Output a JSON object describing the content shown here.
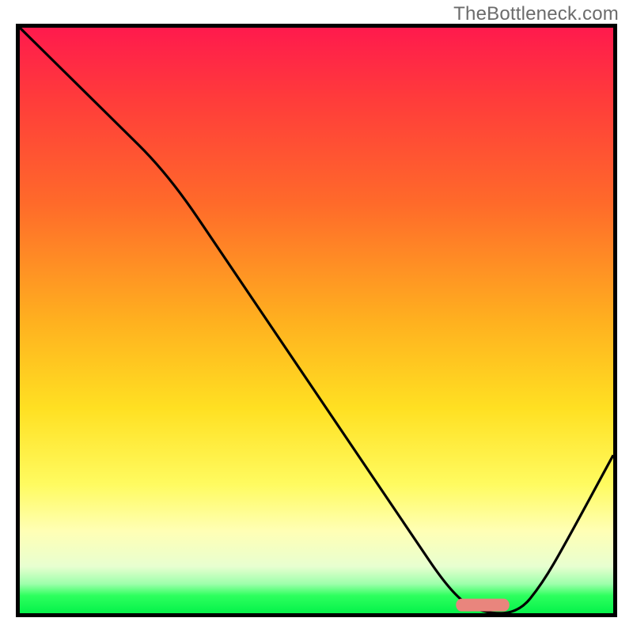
{
  "watermark": "TheBottleneck.com",
  "chart_data": {
    "type": "line",
    "title": "",
    "xlabel": "",
    "ylabel": "",
    "xlim": [
      0,
      100
    ],
    "ylim": [
      0,
      100
    ],
    "series": [
      {
        "name": "bottleneck-curve",
        "x": [
          0,
          15,
          25,
          35,
          45,
          55,
          65,
          73,
          78,
          84,
          88,
          92,
          100
        ],
        "values": [
          100,
          85,
          75,
          60,
          45,
          30,
          15,
          3,
          0,
          0,
          5,
          12,
          27
        ]
      }
    ],
    "marker": {
      "name": "optimal-pill",
      "x": 78,
      "width": 9,
      "y": 1,
      "color": "#e9857d"
    },
    "gradient_stops": [
      {
        "pos": 0,
        "color": "#ff1a4d"
      },
      {
        "pos": 30,
        "color": "#ff6a2a"
      },
      {
        "pos": 65,
        "color": "#ffe022"
      },
      {
        "pos": 92,
        "color": "#e8ffd0"
      },
      {
        "pos": 100,
        "color": "#05f24a"
      }
    ]
  }
}
